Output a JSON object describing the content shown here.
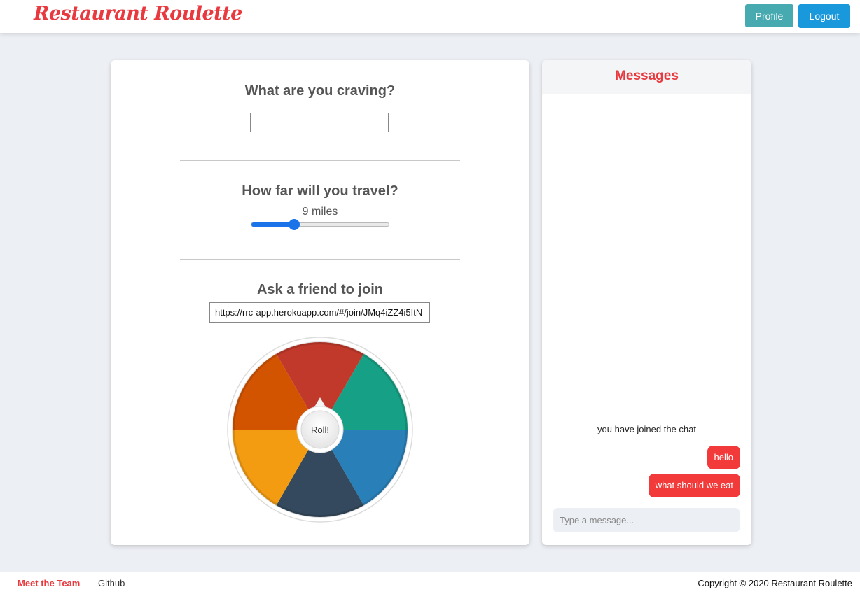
{
  "app": {
    "logo": "Restaurant Roulette"
  },
  "nav": {
    "profile_label": "Profile",
    "logout_label": "Logout"
  },
  "search": {
    "craving_title": "What are you craving?",
    "craving_value": "",
    "distance_title": "How far will you travel?",
    "distance_label": "9 miles",
    "distance_value_fraction": 0.31,
    "invite_title": "Ask a friend to join",
    "invite_link": "https://rrc-app.herokuapp.com/#/join/JMq4iZZ4i5ItN"
  },
  "wheel": {
    "roll_label": "Roll!",
    "segment_colors": [
      "#c0392b",
      "#16a085",
      "#2980b9",
      "#34495e",
      "#f39c12",
      "#d35400"
    ]
  },
  "messages": {
    "title": "Messages",
    "system_message": "you have joined the chat",
    "items": [
      {
        "text": "hello"
      },
      {
        "text": "what should we eat"
      }
    ],
    "input_placeholder": "Type a message..."
  },
  "footer": {
    "meet_label": "Meet the Team",
    "github_label": "Github",
    "copyright": "Copyright © 2020 Restaurant Roulette"
  },
  "colors": {
    "brand": "#e8393f",
    "profile": "#46aab0",
    "logout": "#1a98dc",
    "bubble": "#f23a3a",
    "slider": "#1a73e8"
  }
}
